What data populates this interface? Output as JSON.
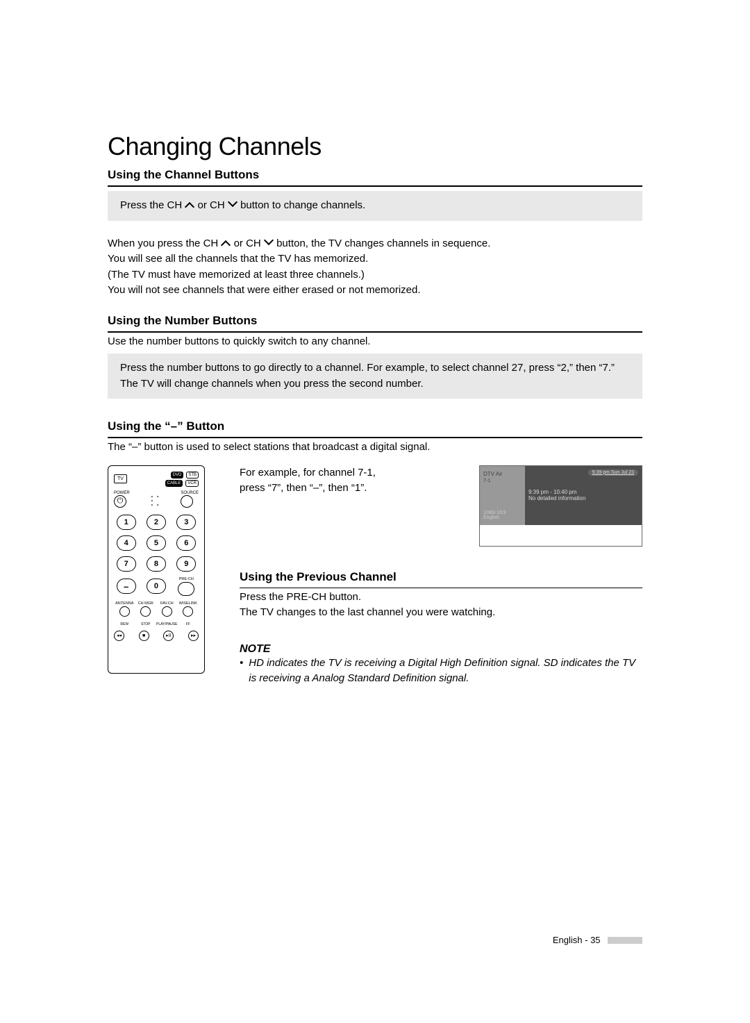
{
  "title": "Changing Channels",
  "sections": {
    "ch_buttons": {
      "heading": "Using the Channel Buttons",
      "box_pre": "Press the CH ",
      "box_mid": " or CH ",
      "box_post": " button to change channels.",
      "p1_pre": "When you press the CH ",
      "p1_mid": " or CH ",
      "p1_post": " button, the TV changes channels in sequence.",
      "p2": "You will see all the channels that the TV has memorized.",
      "p3": "(The TV must have memorized at least three channels.)",
      "p4": "You will not see channels that were either erased or not memorized."
    },
    "num_buttons": {
      "heading": "Using the Number Buttons",
      "p1": "Use the number buttons to quickly switch to any channel.",
      "box": "Press the number buttons to go directly to a channel. For example, to select channel 27, press “2,” then “7.” The TV will change channels when you press the second number."
    },
    "dash_button": {
      "heading": "Using the “–” Button",
      "p1": "The “–” button is used to select stations that broadcast a digital signal.",
      "example_l1": "For example, for channel 7-1,",
      "example_l2": "press “7”, then “–”, then “1”."
    },
    "prev_ch": {
      "heading": "Using the Previous Channel",
      "p1": "Press the PRE-CH button.",
      "p2": "The TV changes to the last channel you were watching."
    },
    "note": {
      "heading": "NOTE",
      "body": "HD indicates the TV is receiving a Digital High Definition signal. SD indicates the TV is receiving a Analog Standard Definition signal."
    }
  },
  "remote": {
    "tv": "TV",
    "dvd": "DVD",
    "stb": "STB",
    "cable": "CABLE",
    "vcr": "VCR",
    "power": "POWER",
    "source": "SOURCE",
    "keys": [
      "1",
      "2",
      "3",
      "4",
      "5",
      "6",
      "7",
      "8",
      "9",
      "–",
      "0",
      ""
    ],
    "prech": "PRE-CH",
    "nav": [
      "ANTENNA",
      "CH MGR",
      "FAV.CH",
      "WISELINK"
    ],
    "media": [
      "REW",
      "STOP",
      "PLAY/PAUSE",
      "FF"
    ]
  },
  "osd": {
    "source": "DTV Air",
    "channel": "7-1",
    "res": "1080i 16:9",
    "lang": "English",
    "clock": "9:39 pm Sun Jul 23",
    "time": "9:39 pm - 10:40 pm",
    "info": "No detailed information"
  },
  "footer": "English - 35"
}
